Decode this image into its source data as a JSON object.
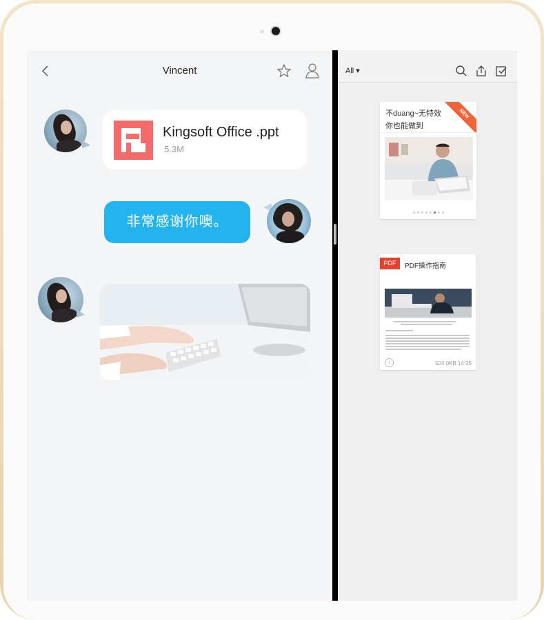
{
  "chat": {
    "title": "Vincent",
    "file_message": {
      "name": "Kingsoft Office .ppt",
      "size": "5.3M"
    },
    "text_message": "非常感谢你噢。"
  },
  "docs": {
    "filter_label": "All ▾",
    "cards": [
      {
        "line1": "不duang~无特效",
        "line2": "你也能做到",
        "badge": "NEW",
        "slide_count": 8,
        "active_slide": 5
      },
      {
        "badge": "PDF",
        "title": "PDF操作指南",
        "meta": "524.0KB  14:25"
      }
    ]
  },
  "colors": {
    "accent_blue": "#23b4ef",
    "ppt_red": "#f36b6b",
    "pdf_red": "#e4422f",
    "new_orange": "#f0643a"
  }
}
